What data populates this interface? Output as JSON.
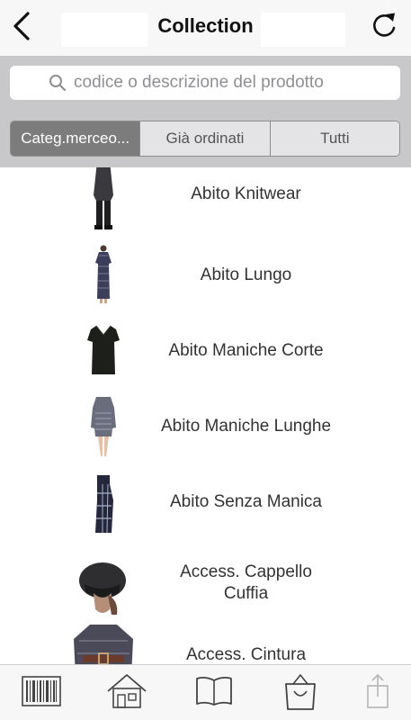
{
  "header": {
    "title": "Collection",
    "back_icon": "chevron-left-icon",
    "refresh_icon": "refresh-icon"
  },
  "search": {
    "placeholder": "codice o descrizione del prodotto",
    "value": "",
    "icon": "search-icon"
  },
  "segments": [
    {
      "label": "Categ.merceo...",
      "active": true
    },
    {
      "label": "Già ordinati",
      "active": false
    },
    {
      "label": "Tutti",
      "active": false
    }
  ],
  "categories": [
    {
      "label": "Abito Knitwear"
    },
    {
      "label": "Abito Lungo"
    },
    {
      "label": "Abito Maniche Corte"
    },
    {
      "label": "Abito Maniche Lunghe"
    },
    {
      "label": "Abito Senza Manica"
    },
    {
      "label": "Access. Cappello\nCuffia"
    },
    {
      "label": "Access. Cintura"
    }
  ],
  "tabbar": [
    {
      "icon": "barcode-icon"
    },
    {
      "icon": "home-icon"
    },
    {
      "icon": "catalog-book-icon"
    },
    {
      "icon": "shopping-bag-icon"
    },
    {
      "icon": "share-icon"
    }
  ],
  "colors": {
    "header_bg": "#f7f7f7",
    "search_area_bg": "#c8c8ca",
    "segment_active_bg": "#7c7c7c",
    "segment_bg": "#e4e4e6",
    "text": "#333333"
  }
}
